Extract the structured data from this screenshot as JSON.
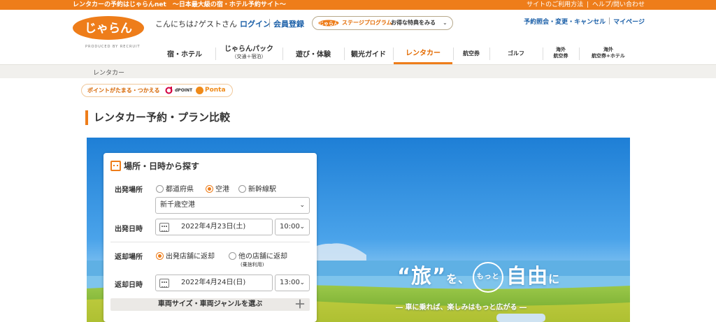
{
  "topbar": {
    "tagline": "レンタカーの予約はじゃらんnet　～日本最大級の宿・ホテル予約サイト～",
    "help_links": [
      "サイトのご利用方法",
      "|",
      "ヘルプ/問い合わせ"
    ]
  },
  "header": {
    "logo_text": "じゃらん",
    "logo_sub": "PRODUCED BY RECRUIT",
    "greeting": "こんにちは♪ゲストさん",
    "login": "ログイン",
    "register": "会員登録",
    "stage_logo": "じゃらん",
    "stage_program": "ステージプログラム",
    "stage_deal": "お得な特典をみる",
    "user_links": [
      "予約照会・変更・キャンセル",
      "マイページ"
    ]
  },
  "nav": {
    "items": [
      {
        "label": "宿・ホテル"
      },
      {
        "label": "じゃらんパック",
        "sub": "（交通＋宿泊）"
      },
      {
        "label": "遊び・体験"
      },
      {
        "label": "観光ガイド"
      },
      {
        "label": "レンタカー"
      },
      {
        "label": "航空券"
      },
      {
        "label": "ゴルフ"
      },
      {
        "label": "海外",
        "sub": "航空券"
      },
      {
        "label": "海外",
        "sub": "航空券+ホテル"
      }
    ],
    "active": "レンタカー"
  },
  "breadcrumb": "レンタカー",
  "points": {
    "text": "ポイントがたまる・つかえる",
    "dpoint": "dPOINT",
    "ponta": "Ponta"
  },
  "page_title": "レンタカー予約・プラン比較",
  "search": {
    "heading": "場所・日時から探す",
    "departure_place_label": "出発場所",
    "departure_options": [
      "都道府県",
      "空港",
      "新幹線駅"
    ],
    "departure_selected": "空港",
    "airport_value": "新千歳空港",
    "departure_datetime_label": "出発日時",
    "departure_date": "2022年4月23日(土)",
    "departure_time": "10:00",
    "return_place_label": "返却場所",
    "return_options": [
      "出発店舗に返却",
      "他の店舗に返却"
    ],
    "return_option_note": "(乗捨利用)",
    "return_selected": "出発店舗に返却",
    "return_datetime_label": "返却日時",
    "return_date": "2022年4月24日(日)",
    "return_time": "13:00",
    "vehicle_label": "車両サイズ・車両ジャンルを選ぶ"
  },
  "hero": {
    "slogan_main_1": "“旅”",
    "slogan_small_1": "を、",
    "slogan_circle": "もっと",
    "slogan_main_2": "自由",
    "slogan_small_2": "に",
    "slogan_sub": "― 車に乗れば、楽しみはもっと広がる ―"
  },
  "colors": {
    "accent": "#ee7d1a",
    "link": "#1a5fa8",
    "crumb_bg": "#f1f0ed"
  }
}
